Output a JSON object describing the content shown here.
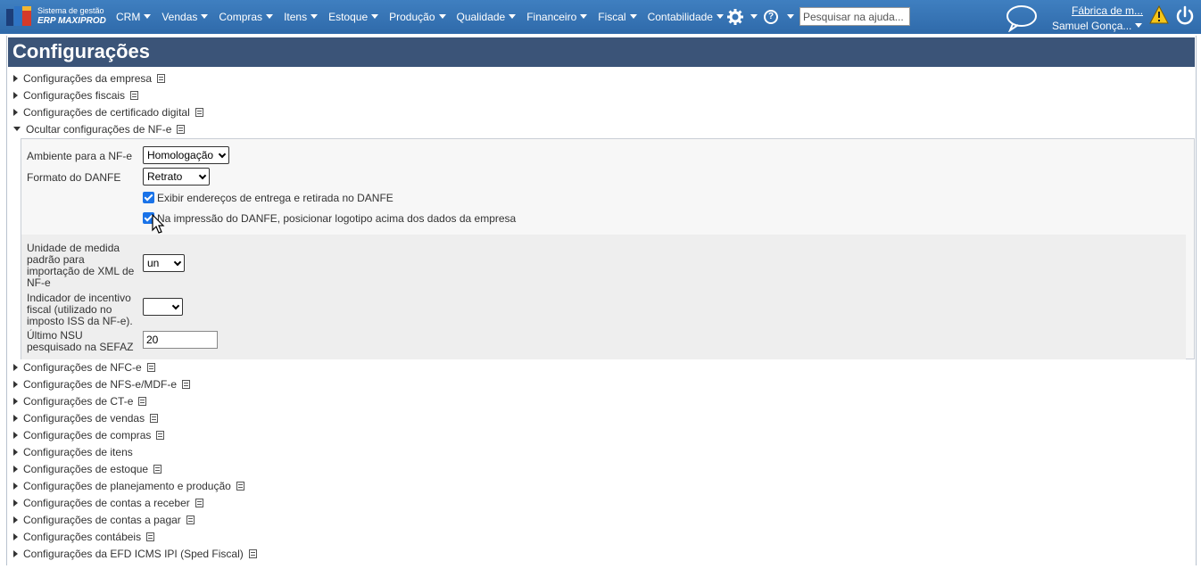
{
  "brand": {
    "line1": "Sistema de gestão",
    "line2": "ERP MAXIPROD"
  },
  "menu": [
    "CRM",
    "Vendas",
    "Compras",
    "Itens",
    "Estoque",
    "Produção",
    "Qualidade",
    "Financeiro",
    "Fiscal",
    "Contabilidade"
  ],
  "search": {
    "placeholder": "Pesquisar na ajuda..."
  },
  "header_right": {
    "company": "Fábrica de m...",
    "user": "Samuel Gonça..."
  },
  "page": {
    "title": "Configurações"
  },
  "sections_top": [
    {
      "label": "Configurações da empresa",
      "doc": true
    },
    {
      "label": "Configurações fiscais",
      "doc": true
    },
    {
      "label": "Configurações de certificado digital",
      "doc": true
    },
    {
      "label": "Ocultar configurações de NF-e",
      "doc": true
    }
  ],
  "nfe": {
    "ambiente_label": "Ambiente para a NF-e",
    "ambiente_value": "Homologação",
    "formato_label": "Formato do DANFE",
    "formato_value": "Retrato",
    "chk1_label": "Exibir endereços de entrega e retirada no DANFE",
    "chk1_checked": true,
    "chk2_label": "Na impressão do DANFE, posicionar logotipo acima dos dados da empresa",
    "chk2_checked": true,
    "unidade_label_lines": [
      "Unidade de medida",
      "padrão para",
      "importação de XML de",
      "NF-e"
    ],
    "unidade_value": "un",
    "incentivo_label_lines": [
      "Indicador de incentivo",
      "fiscal (utilizado no",
      "imposto ISS da NF-e)."
    ],
    "incentivo_value": "",
    "nsu_label_lines": [
      "Último NSU",
      "pesquisado na SEFAZ"
    ],
    "nsu_value": "20"
  },
  "sections_bottom": [
    {
      "label": "Configurações de NFC-e",
      "doc": true
    },
    {
      "label": "Configurações de NFS-e/MDF-e",
      "doc": true
    },
    {
      "label": "Configurações de CT-e",
      "doc": true
    },
    {
      "label": "Configurações de vendas",
      "doc": true
    },
    {
      "label": "Configurações de compras",
      "doc": true
    },
    {
      "label": "Configurações de itens",
      "doc": false
    },
    {
      "label": "Configurações de estoque",
      "doc": true
    },
    {
      "label": "Configurações de planejamento e produção",
      "doc": true
    },
    {
      "label": "Configurações de contas a receber",
      "doc": true
    },
    {
      "label": "Configurações de contas a pagar",
      "doc": true
    },
    {
      "label": "Configurações contábeis",
      "doc": true
    },
    {
      "label": "Configurações da EFD ICMS IPI (Sped Fiscal)",
      "doc": true
    }
  ],
  "colors": {
    "topbar": "#3375b7",
    "header": "#3b5478",
    "checkbox": "#1a73e8"
  }
}
